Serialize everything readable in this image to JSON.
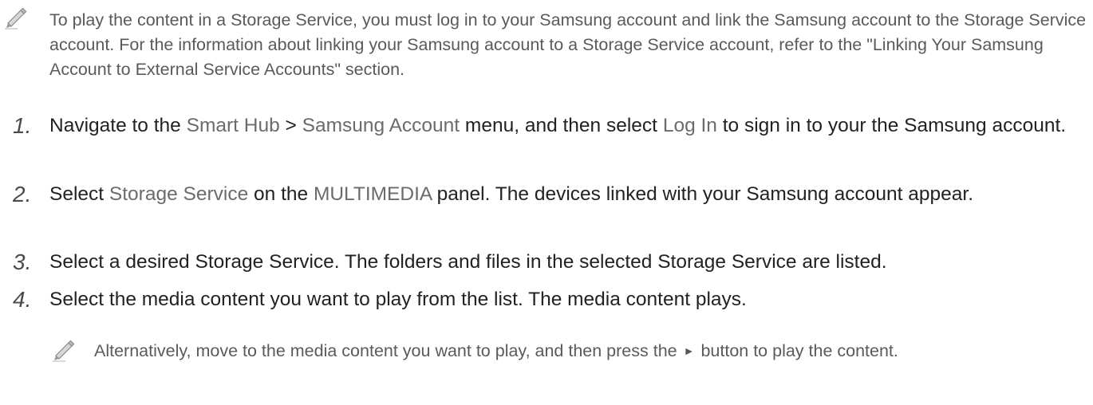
{
  "top_note": {
    "icon": "pencil-icon",
    "text": "To play the content in a Storage Service, you must log in to your Samsung account and link the Samsung account to the Storage Service account. For the information about linking your Samsung account to a Storage Service account, refer to the \"Linking Your Samsung Account to External Service Accounts\" section."
  },
  "steps": [
    {
      "number": "1.",
      "parts": [
        "Navigate to the ",
        "Smart Hub",
        " > ",
        "Samsung Account",
        " menu, and then select ",
        "Log In",
        " to sign in to your the Samsung account."
      ]
    },
    {
      "number": "2.",
      "parts": [
        "Select ",
        "Storage Service",
        " on the ",
        "MULTIMEDIA",
        " panel. The devices linked with your Samsung account appear."
      ]
    },
    {
      "number": "3.",
      "text": "Select a desired Storage Service. The folders and files in the selected Storage Service are listed."
    },
    {
      "number": "4.",
      "text": "Select the media content you want to play from the list. The media content plays."
    }
  ],
  "sub_note": {
    "icon": "pencil-icon",
    "text_before": "Alternatively, move to the media content you want to play, and then press the",
    "button_symbol": "►",
    "text_after": "button to play the content."
  }
}
